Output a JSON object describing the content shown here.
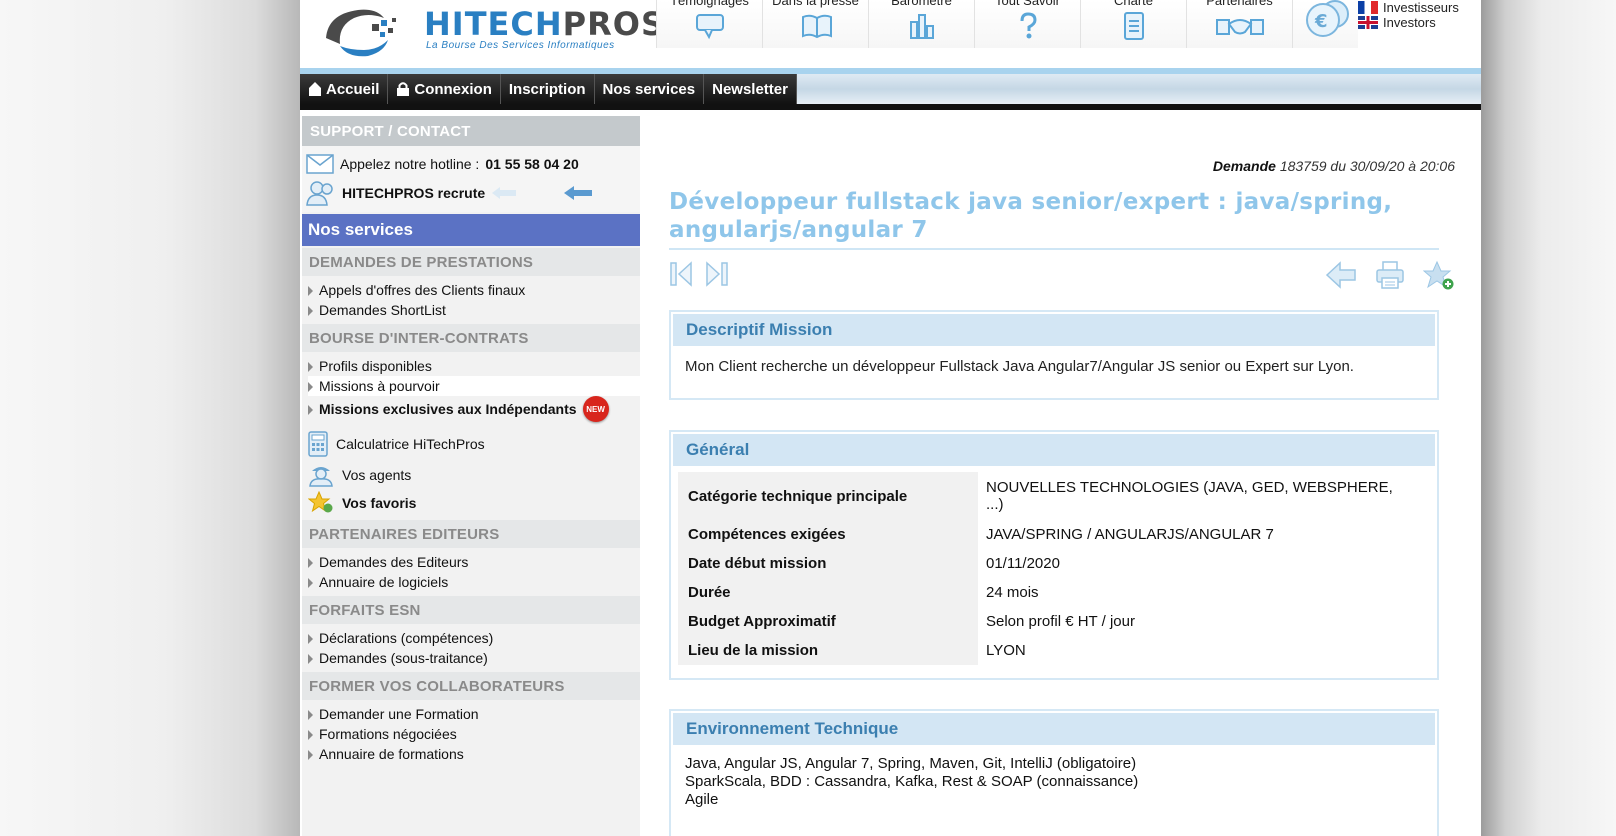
{
  "header": {
    "logo_main": "HITECH",
    "logo_accent": "PROS",
    "tagline": "La Bourse Des Services Informatiques",
    "topnav": [
      {
        "label": "Témoignages",
        "icon": "speech-bubble-icon"
      },
      {
        "label": "Dans la presse",
        "icon": "open-book-icon"
      },
      {
        "label": "Baromètre",
        "icon": "bar-chart-icon"
      },
      {
        "label": "Tout Savoir",
        "icon": "question-mark-icon"
      },
      {
        "label": "Charte",
        "icon": "document-icon"
      },
      {
        "label": "Partenaires",
        "icon": "handshake-icon"
      }
    ],
    "lang": [
      {
        "label": "Investisseurs",
        "flag": "fr"
      },
      {
        "label": "Investors",
        "flag": "uk"
      }
    ]
  },
  "menu": [
    {
      "label": "Accueil",
      "icon": "home-icon"
    },
    {
      "label": "Connexion",
      "icon": "lock-icon"
    },
    {
      "label": "Inscription"
    },
    {
      "label": "Nos services"
    },
    {
      "label": "Newsletter"
    }
  ],
  "sidebar": {
    "support_title": "SUPPORT / CONTACT",
    "hotline_label": "Appelez notre hotline :",
    "hotline_number": "01 55 58 04 20",
    "recrute": "HITECHPROS recrute",
    "services_title": "Nos services",
    "sections": [
      {
        "title": "DEMANDES DE PRESTATIONS",
        "links": [
          "Appels d'offres des Clients finaux",
          "Demandes ShortList"
        ]
      },
      {
        "title": "BOURSE D'INTER-CONTRATS",
        "links": [
          "Profils disponibles",
          "Missions à pourvoir"
        ],
        "exclusive": "Missions exclusives aux Indépendants",
        "new_badge": "NEW"
      },
      {
        "title": "PARTENAIRES EDITEURS",
        "links": [
          "Demandes des Editeurs",
          "Annuaire de logiciels"
        ]
      },
      {
        "title": "FORFAITS ESN",
        "links": [
          "Déclarations (compétences)",
          "Demandes (sous-traitance)"
        ]
      },
      {
        "title": "FORMER VOS COLLABORATEURS",
        "links": [
          "Demander une Formation",
          "Formations négociées",
          "Annuaire de formations"
        ]
      }
    ],
    "tools": [
      "Calculatrice HiTechPros",
      "Vos agents",
      "Vos favoris"
    ]
  },
  "demande": {
    "label": "Demande",
    "detail": "183759 du 30/09/20 à 20:06",
    "title": "Développeur fullstack java senior/expert : java/spring, angularjs/angular 7"
  },
  "descriptif": {
    "title": "Descriptif Mission",
    "text": "Mon Client recherche un développeur Fullstack Java Angular7/Angular JS senior ou Expert sur Lyon."
  },
  "general": {
    "title": "Général",
    "rows": [
      {
        "key": "Catégorie technique principale",
        "value": "NOUVELLES TECHNOLOGIES (JAVA, GED, WEBSPHERE, ...)"
      },
      {
        "key": "Compétences exigées",
        "value": "JAVA/SPRING / ANGULARJS/ANGULAR 7"
      },
      {
        "key": "Date début mission",
        "value": "01/11/2020"
      },
      {
        "key": "Durée",
        "value": "24 mois"
      },
      {
        "key": "Budget Approximatif",
        "value": "Selon profil € HT / jour"
      },
      {
        "key": "Lieu de la mission",
        "value": "LYON"
      }
    ]
  },
  "environnement": {
    "title": "Environnement Technique",
    "lines": [
      "Java, Angular JS, Angular 7, Spring, Maven, Git, IntelliJ (obligatoire)",
      "SparkScala, BDD : Cassandra, Kafka, Rest & SOAP (connaissance)",
      "Agile"
    ]
  },
  "colors": {
    "accent_blue": "#5b72c4",
    "title_blue": "#8fc6ea",
    "panel_head": "#d3e6f4",
    "new_red": "#d8261d"
  }
}
